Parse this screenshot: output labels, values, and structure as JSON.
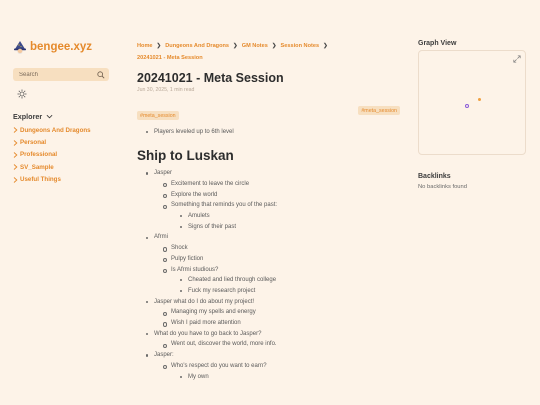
{
  "site": {
    "title": "bengee.xyz"
  },
  "search": {
    "placeholder": "Search"
  },
  "explorer": {
    "title": "Explorer",
    "items": [
      {
        "label": "Dungeons And Dragons"
      },
      {
        "label": "Personal"
      },
      {
        "label": "Professional"
      },
      {
        "label": "SV_Sample"
      },
      {
        "label": "Useful Things"
      }
    ]
  },
  "breadcrumb": {
    "items": [
      "Home",
      "Dungeons And Dragons",
      "GM Notes",
      "Session Notes",
      "20241021 - Meta Session"
    ]
  },
  "page": {
    "title": "20241021 - Meta Session",
    "date": "Jun 30, 2025",
    "read_time": "1 min read",
    "tag_right": "#meta_session",
    "tag_left": "#meta_session",
    "summary_items": [
      "Players leveled up to 6th level"
    ],
    "section_heading": "Ship to Luskan",
    "items": [
      {
        "level": 1,
        "text": "Jasper"
      },
      {
        "level": 2,
        "text": "Excitement to leave the circle"
      },
      {
        "level": 2,
        "text": "Explore the world"
      },
      {
        "level": 2,
        "text": "Something that reminds you of the past:"
      },
      {
        "level": 3,
        "text": "Amulets"
      },
      {
        "level": 3,
        "text": "Signs of their past"
      },
      {
        "level": 1,
        "text": "Afrmi"
      },
      {
        "level": 2,
        "text": "Shock"
      },
      {
        "level": 2,
        "text": "Pulpy fiction"
      },
      {
        "level": 2,
        "text": "Is Afrmi studious?"
      },
      {
        "level": 3,
        "text": "Cheated and lied through college"
      },
      {
        "level": 3,
        "text": "Fuck my research project"
      },
      {
        "level": 1,
        "text": "Jasper what do I do about my project!"
      },
      {
        "level": 2,
        "text": "Managing my spells and energy"
      },
      {
        "level": 2,
        "text": "Wish I paid more attention"
      },
      {
        "level": 1,
        "text": "What do you have to go back to Jasper?"
      },
      {
        "level": 2,
        "text": "Went out, discover the world, more info."
      },
      {
        "level": 1,
        "text": "Jasper:"
      },
      {
        "level": 2,
        "text": "Who's respect do you want to earn?"
      },
      {
        "level": 3,
        "text": "My own"
      }
    ]
  },
  "graph": {
    "title": "Graph View"
  },
  "backlinks": {
    "title": "Backlinks",
    "empty_text": "No backlinks found"
  },
  "colors": {
    "accent": "#e58a2c",
    "background": "#fdf3e8",
    "tag_bg": "#f7dfc0"
  }
}
